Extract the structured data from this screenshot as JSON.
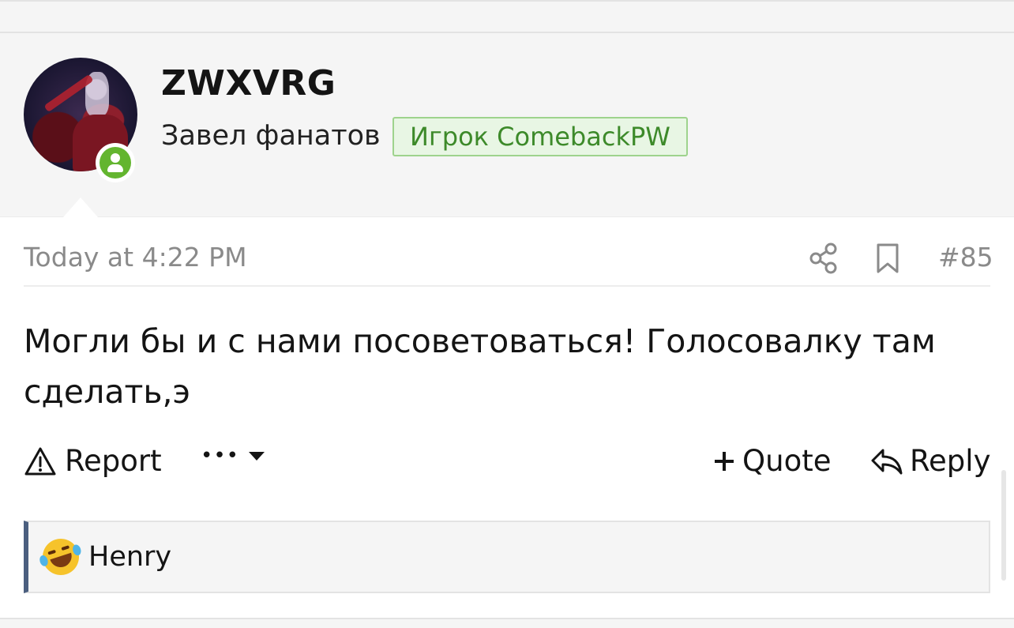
{
  "user": {
    "name": "ZWXVRG",
    "title": "Завел фанатов",
    "banner": "Игрок ComebackPW",
    "status": "online"
  },
  "post": {
    "timestamp": "Today at 4:22 PM",
    "number": "#85",
    "body": "Могли бы и с нами посоветоваться! Голосовалку там сделать,э"
  },
  "actions": {
    "report_label": "Report",
    "more_label": "•••",
    "quote_label": "Quote",
    "reply_label": "Reply"
  },
  "reactions": {
    "emoji": "rolling-on-floor-laughing",
    "user": "Henry"
  },
  "colors": {
    "banner_border": "#9ed38d",
    "banner_bg": "#e8f6e4",
    "banner_text": "#3d8a2a",
    "online": "#63b52f",
    "reaction_accent": "#4b5f7f",
    "meta_text": "#8a8a8a"
  },
  "icons": [
    "share-icon",
    "bookmark-icon",
    "warning-icon",
    "caret-down-icon",
    "plus-icon",
    "reply-arrow-icon",
    "user-icon"
  ]
}
